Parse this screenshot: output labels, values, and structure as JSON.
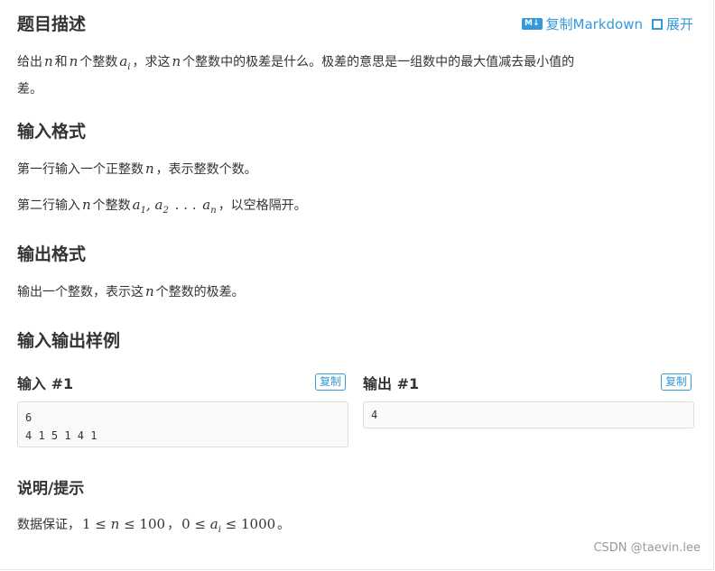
{
  "actions": {
    "copy_markdown": "复制Markdown",
    "expand": "展开",
    "md_badge": "M↓"
  },
  "description": {
    "title": "题目描述",
    "t1": "给出",
    "v_n": "n",
    "t2": "和",
    "t3": "个整数",
    "v_ai": "a",
    "v_i": "i",
    "t4": "，求这",
    "t5": "个整数中的极差是什么。极差的意思是一组数中的最大值减去最小值的",
    "t6": "差。"
  },
  "input_format": {
    "title": "输入格式",
    "line1_a": "第一行输入一个正整数",
    "line1_b": "，表示整数个数。",
    "line2_a": "第二行输入",
    "line2_b": "个整数",
    "line2_math": "a",
    "line2_sub1": "1",
    "line2_sub2": "2",
    "line2_dots": ". . .",
    "line2_subn": "n",
    "line2_c": "，以空格隔开。"
  },
  "output_format": {
    "title": "输出格式",
    "line_a": "输出一个整数，表示这",
    "line_b": "个整数的极差。"
  },
  "samples": {
    "title": "输入输出样例",
    "input_label": "输入 #1",
    "output_label": "输出 #1",
    "copy": "复制",
    "input_text": "6\n4 1 5 1 4 1",
    "output_text": "4"
  },
  "hint": {
    "title": "说明/提示",
    "a": "数据保证，",
    "m1": "1 ≤ ",
    "m2": " ≤ 100",
    "sep": "，",
    "m3": "0 ≤ ",
    "m4": " ≤ 1000",
    "end": "。"
  },
  "watermark": "CSDN @taevin.lee"
}
